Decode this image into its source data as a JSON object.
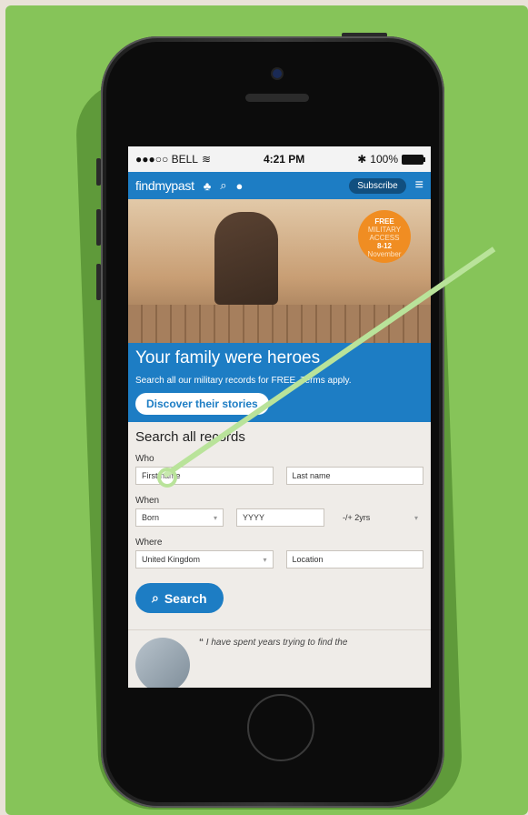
{
  "status_bar": {
    "carrier": "●●●○○ BELL",
    "time": "4:21 PM",
    "battery": "100%"
  },
  "nav": {
    "logo": "findmypast",
    "subscribe": "Subscribe"
  },
  "hero": {
    "badge_line1": "FREE",
    "badge_line2": "MILITARY",
    "badge_line3": "ACCESS",
    "badge_line4": "8-12",
    "badge_line5": "November"
  },
  "promo": {
    "title": "Your family were heroes",
    "text": "Search all our military records for FREE. Terms apply.",
    "button": "Discover their stories"
  },
  "search": {
    "title": "Search all records",
    "who_label": "Who",
    "first_name_placeholder": "First name",
    "last_name_placeholder": "Last name",
    "when_label": "When",
    "born_value": "Born",
    "year_placeholder": "YYYY",
    "range_value": "-/+ 2yrs",
    "where_label": "Where",
    "country_value": "United Kingdom",
    "location_placeholder": "Location",
    "search_button": "Search"
  },
  "testimonial": {
    "quote": "I have spent years trying to find the"
  },
  "colors": {
    "brand_blue": "#1d7dc4",
    "badge_orange": "#f08d22",
    "background_green": "#86c459",
    "highlight_green": "#b9e39a"
  },
  "icons": [
    "wifi-icon",
    "bluetooth-icon",
    "battery-icon",
    "family-tree-icon",
    "search-icon",
    "chat-icon",
    "menu-icon",
    "chevron-down-icon",
    "quote-icon"
  ]
}
